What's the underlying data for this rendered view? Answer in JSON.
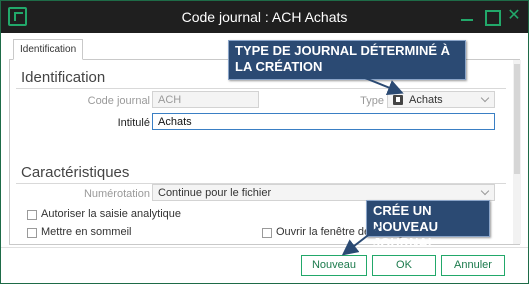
{
  "window": {
    "title": "Code journal : ACH Achats",
    "controls": {
      "minimize_icon": "minimize-icon",
      "maximize_icon": "maximize-icon",
      "close_glyph": "✕"
    },
    "accent_color": "#22a86a"
  },
  "tabs": [
    {
      "label": "Identification",
      "active": true
    }
  ],
  "identification": {
    "section_title": "Identification",
    "code_label": "Code journal",
    "code_value": "ACH",
    "type_label": "Type",
    "type_value": "Achats",
    "intitule_label": "Intitulé",
    "intitule_value": "Achats"
  },
  "caracteristiques": {
    "section_title": "Caractéristiques",
    "numerotation_label": "Numérotation",
    "numerotation_value": "Continue pour le fichier",
    "checkbox_analytique": "Autoriser la saisie analytique",
    "checkbox_sommeil": "Mettre en sommeil",
    "checkbox_lettrage": "Ouvrir la fenêtre de lettrage en saisie"
  },
  "buttons": {
    "nouveau": "Nouveau",
    "ok": "OK",
    "annuler": "Annuler"
  },
  "annotations": {
    "callout_type": "TYPE DE JOURNAL DÉTERMINÉ À LA CRÉATION",
    "callout_nouveau": "CRÉE UN NOUVEAU JOURNAL",
    "callout_color": "#2b4a73"
  }
}
